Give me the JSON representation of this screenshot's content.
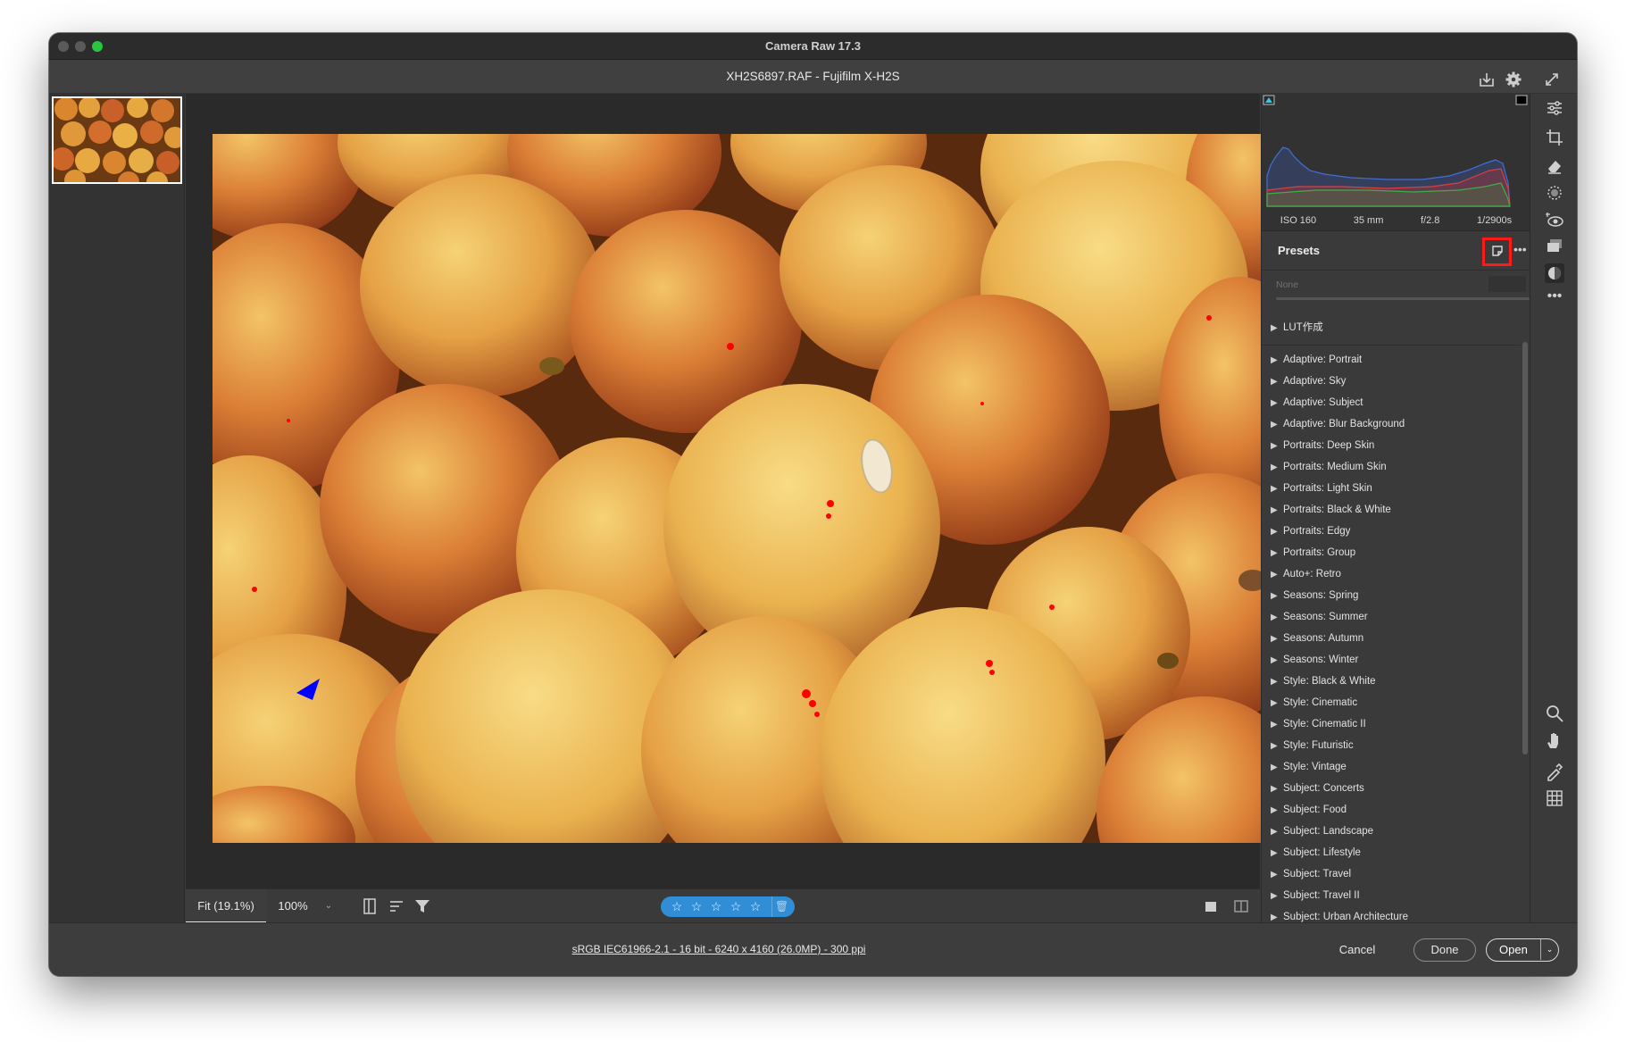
{
  "window": {
    "title": "Camera Raw 17.3"
  },
  "header": {
    "file_title": "XH2S6897.RAF  -  Fujifilm X-H2S"
  },
  "exif": {
    "iso": "ISO 160",
    "focal": "35 mm",
    "aperture": "f/2.8",
    "shutter": "1/2900s"
  },
  "presets": {
    "title": "Presets",
    "amount_placeholder": "None",
    "groups": [
      "LUT作成",
      "Adaptive: Portrait",
      "Adaptive: Sky",
      "Adaptive: Subject",
      "Adaptive: Blur Background",
      "Portraits: Deep Skin",
      "Portraits: Medium Skin",
      "Portraits: Light Skin",
      "Portraits: Black & White",
      "Portraits: Edgy",
      "Portraits: Group",
      "Auto+: Retro",
      "Seasons: Spring",
      "Seasons: Summer",
      "Seasons: Autumn",
      "Seasons: Winter",
      "Style: Black & White",
      "Style: Cinematic",
      "Style: Cinematic II",
      "Style: Futuristic",
      "Style: Vintage",
      "Subject: Concerts",
      "Subject: Food",
      "Subject: Landscape",
      "Subject: Lifestyle",
      "Subject: Travel",
      "Subject: Travel II",
      "Subject: Urban Architecture"
    ]
  },
  "zoom": {
    "fit_label": "Fit (19.1%)",
    "actual_label": "100%"
  },
  "rating": {
    "stars": 0,
    "max": 5
  },
  "footer": {
    "file_info": "sRGB IEC61966-2.1 - 16 bit - 6240 x 4160 (26.0MP) - 300 ppi",
    "cancel_label": "Cancel",
    "done_label": "Done",
    "open_label": "Open"
  },
  "colors": {
    "rating_bg": "#2f8ed6",
    "highlight_box": "#ff1a1a",
    "traffic_green": "#27c840"
  }
}
